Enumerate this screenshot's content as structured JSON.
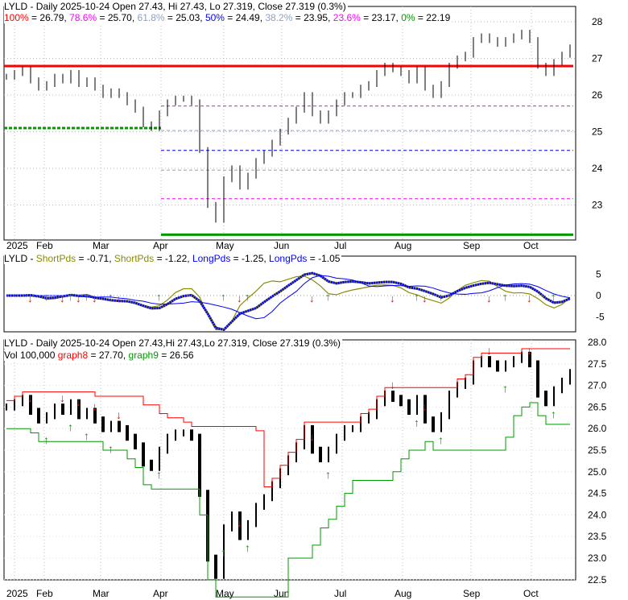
{
  "colors": {
    "red": "#ff0000",
    "magenta": "#ff00ff",
    "gray": "#8fa0c0",
    "blue": "#0000ff",
    "green": "#009900",
    "olive": "#8b8b00"
  },
  "panel1": {
    "title": "LYLD - Daily 2025-10-24 Open 27.43, Hi 27.43, Lo 27.319, Close 27.319 (0.3%)",
    "fib": [
      {
        "label": "100%",
        "value": "26.79",
        "v": 26.79,
        "color": "#ff0000"
      },
      {
        "label": "78.6%",
        "value": "25.70",
        "v": 25.7,
        "color": "#ff00ff"
      },
      {
        "label": "61.8%",
        "value": "25.03",
        "v": 25.03,
        "color": "#8fa0c0"
      },
      {
        "label": "50%",
        "value": "24.49",
        "v": 24.49,
        "color": "#0000ff"
      },
      {
        "label": "38.2%",
        "value": "23.95",
        "v": 23.95,
        "color": "#8fa0c0"
      },
      {
        "label": "23.6%",
        "value": "23.17",
        "v": 23.17,
        "color": "#ff00ff"
      },
      {
        "label": "0%",
        "value": "22.19",
        "v": 22.19,
        "color": "#009900"
      }
    ]
  },
  "panel2": {
    "prefix": "LYLD - ",
    "items": [
      {
        "label": "ShortPds",
        "value": "-0.71",
        "color": "#8b8b00"
      },
      {
        "label": "ShortPds",
        "value": "-1.22",
        "color": "#8b8b00"
      },
      {
        "label": "LongPds",
        "value": "-1.25",
        "color": "#0000ff"
      },
      {
        "label": "LongPds",
        "value": "-1.05",
        "color": "#0000ff"
      }
    ]
  },
  "panel3": {
    "title": "LYLD - Daily 2025-10-24 Open 27.43,Hi 27.43,Lo 27.319, Close 27.319 (0.3%)",
    "vol": "Vol 100,000",
    "g8label": "graph8",
    "g8": "27.70",
    "g9label": "graph9",
    "g9": "26.56"
  },
  "chart_data": {
    "type": "candlestick",
    "title": "LYLD - Daily",
    "xlabels": [
      "2025",
      "Feb",
      "Mar",
      "Apr",
      "May",
      "Jun",
      "Jul",
      "Aug",
      "Sep",
      "Oct"
    ],
    "y1ticks": [
      "28",
      "27",
      "26",
      "25",
      "24",
      "23"
    ],
    "y2ticks": [
      "5",
      "0",
      "-5"
    ],
    "y3ticks": [
      "28.0",
      "27.5",
      "27.0",
      "26.5",
      "26.0",
      "25.5",
      "25.0",
      "24.5",
      "24.0",
      "23.5",
      "23.0",
      "22.5"
    ],
    "close": [
      26.5,
      26.6,
      26.7,
      26.4,
      26.2,
      26.3,
      26.5,
      26.4,
      26.6,
      26.3,
      26.4,
      26.2,
      26.0,
      26.1,
      26.0,
      25.8,
      25.6,
      25.2,
      25.1,
      25.5,
      25.8,
      25.9,
      25.9,
      25.8,
      24.5,
      23.0,
      22.6,
      23.7,
      24.0,
      23.5,
      23.8,
      24.2,
      24.4,
      24.7,
      25.0,
      25.3,
      25.6,
      26.0,
      25.5,
      25.3,
      25.5,
      25.8,
      26.0,
      26.0,
      26.2,
      26.3,
      26.6,
      26.8,
      26.7,
      26.6,
      26.4,
      26.7,
      26.2,
      26.0,
      26.3,
      26.8,
      27.0,
      27.1,
      27.5,
      27.6,
      27.5,
      27.4,
      27.5,
      27.6,
      27.7,
      27.5,
      26.8,
      26.6,
      26.9,
      27.1,
      27.3
    ]
  }
}
